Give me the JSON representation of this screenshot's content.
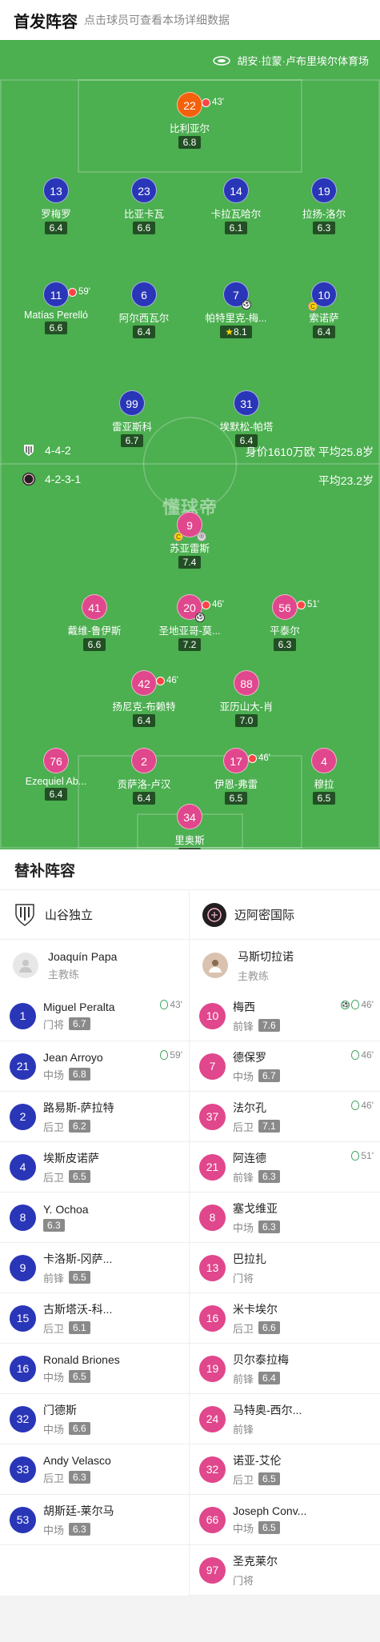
{
  "header": {
    "title": "首发阵容",
    "subtitle": "点击球员可查看本场详细数据"
  },
  "venue": "胡安·拉蒙·卢布里埃尔体育场",
  "watermark": "懂球帝",
  "home": {
    "formation": "4-4-2",
    "value": "身价1610万欧 平均25.8岁",
    "color": "#2a36b8"
  },
  "away": {
    "formation": "4-2-3-1",
    "value": "平均23.2岁",
    "color": "#e0478c"
  },
  "home_players": [
    {
      "num": "22",
      "name": "比利亚尔",
      "rating": "6.8",
      "sub": "43'",
      "team": "orange"
    },
    {
      "num": "13",
      "name": "罗梅罗",
      "rating": "6.4"
    },
    {
      "num": "23",
      "name": "比亚卡瓦",
      "rating": "6.6"
    },
    {
      "num": "14",
      "name": "卡拉瓦哈尔",
      "rating": "6.1"
    },
    {
      "num": "19",
      "name": "拉扬-洛尔",
      "rating": "6.3"
    },
    {
      "num": "11",
      "name": "Matías Perelló",
      "rating": "6.6",
      "sub": "59'"
    },
    {
      "num": "6",
      "name": "阿尔西瓦尔",
      "rating": "6.4"
    },
    {
      "num": "7",
      "name": "帕特里克-梅...",
      "rating": "8.1",
      "star": true,
      "ball": true
    },
    {
      "num": "10",
      "name": "索诺萨",
      "rating": "6.4",
      "card": true
    },
    {
      "num": "99",
      "name": "雷亚斯科",
      "rating": "6.7"
    },
    {
      "num": "31",
      "name": "埃默松-帕塔",
      "rating": "6.4"
    }
  ],
  "away_players": [
    {
      "num": "9",
      "name": "苏亚雷斯",
      "rating": "7.4",
      "card": true,
      "ring": true
    },
    {
      "num": "41",
      "name": "戴维-鲁伊斯",
      "rating": "6.6"
    },
    {
      "num": "20",
      "name": "圣地亚哥-莫...",
      "rating": "7.2",
      "sub": "46'",
      "ball": true
    },
    {
      "num": "56",
      "name": "平泰尔",
      "rating": "6.3",
      "sub": "51'"
    },
    {
      "num": "42",
      "name": "扬尼克-布赖特",
      "rating": "6.4",
      "sub": "46'"
    },
    {
      "num": "88",
      "name": "亚历山大-肖",
      "rating": "7.0"
    },
    {
      "num": "76",
      "name": "Ezequiel Ab...",
      "rating": "6.4"
    },
    {
      "num": "2",
      "name": "贡萨洛-卢汉",
      "rating": "6.4"
    },
    {
      "num": "17",
      "name": "伊恩-弗雷",
      "rating": "6.5",
      "sub": "46'"
    },
    {
      "num": "4",
      "name": "穆拉",
      "rating": "6.5"
    },
    {
      "num": "34",
      "name": "里奥斯",
      "rating": "6.9"
    }
  ],
  "bench": {
    "title": "替补阵容",
    "home": {
      "team": "山谷独立",
      "coach": "Joaquín Papa",
      "coach_role": "主教练",
      "players": [
        {
          "num": "1",
          "name": "Miguel Peralta",
          "pos": "门将",
          "rating": "6.7",
          "ev": "43'"
        },
        {
          "num": "21",
          "name": "Jean Arroyo",
          "pos": "中场",
          "rating": "6.8",
          "ev": "59'"
        },
        {
          "num": "2",
          "name": "路易斯-萨拉特",
          "pos": "后卫",
          "rating": "6.2"
        },
        {
          "num": "4",
          "name": "埃斯皮诺萨",
          "pos": "后卫",
          "rating": "6.5"
        },
        {
          "num": "8",
          "name": "Y. Ochoa",
          "pos": "",
          "rating": "6.3"
        },
        {
          "num": "9",
          "name": "卡洛斯-冈萨...",
          "pos": "前锋",
          "rating": "6.5"
        },
        {
          "num": "15",
          "name": "古斯塔沃-科...",
          "pos": "后卫",
          "rating": "6.1"
        },
        {
          "num": "16",
          "name": "Ronald Briones",
          "pos": "中场",
          "rating": "6.5"
        },
        {
          "num": "32",
          "name": "门德斯",
          "pos": "中场",
          "rating": "6.6"
        },
        {
          "num": "33",
          "name": "Andy Velasco",
          "pos": "后卫",
          "rating": "6.3"
        },
        {
          "num": "53",
          "name": "胡斯廷-莱尔马",
          "pos": "中场",
          "rating": "6.3"
        }
      ]
    },
    "away": {
      "team": "迈阿密国际",
      "coach": "马斯切拉诺",
      "coach_role": "主教练",
      "players": [
        {
          "num": "10",
          "name": "梅西",
          "pos": "前锋",
          "rating": "7.6",
          "ev": "46'",
          "ball": true
        },
        {
          "num": "7",
          "name": "德保罗",
          "pos": "中场",
          "rating": "6.7",
          "ev": "46'"
        },
        {
          "num": "37",
          "name": "法尔孔",
          "pos": "后卫",
          "rating": "7.1",
          "ev": "46'"
        },
        {
          "num": "21",
          "name": "阿连德",
          "pos": "前锋",
          "rating": "6.3",
          "ev": "51'"
        },
        {
          "num": "8",
          "name": "塞戈维亚",
          "pos": "中场",
          "rating": "6.3"
        },
        {
          "num": "13",
          "name": "巴拉扎",
          "pos": "门将",
          "rating": ""
        },
        {
          "num": "16",
          "name": "米卡埃尔",
          "pos": "后卫",
          "rating": "6.6"
        },
        {
          "num": "19",
          "name": "贝尔泰拉梅",
          "pos": "前锋",
          "rating": "6.4"
        },
        {
          "num": "24",
          "name": "马特奥-西尔...",
          "pos": "前锋",
          "rating": ""
        },
        {
          "num": "32",
          "name": "诺亚-艾伦",
          "pos": "后卫",
          "rating": "6.5"
        },
        {
          "num": "66",
          "name": "Joseph Conv...",
          "pos": "中场",
          "rating": "6.5"
        },
        {
          "num": "97",
          "name": "圣克莱尔",
          "pos": "门将",
          "rating": ""
        }
      ]
    }
  }
}
